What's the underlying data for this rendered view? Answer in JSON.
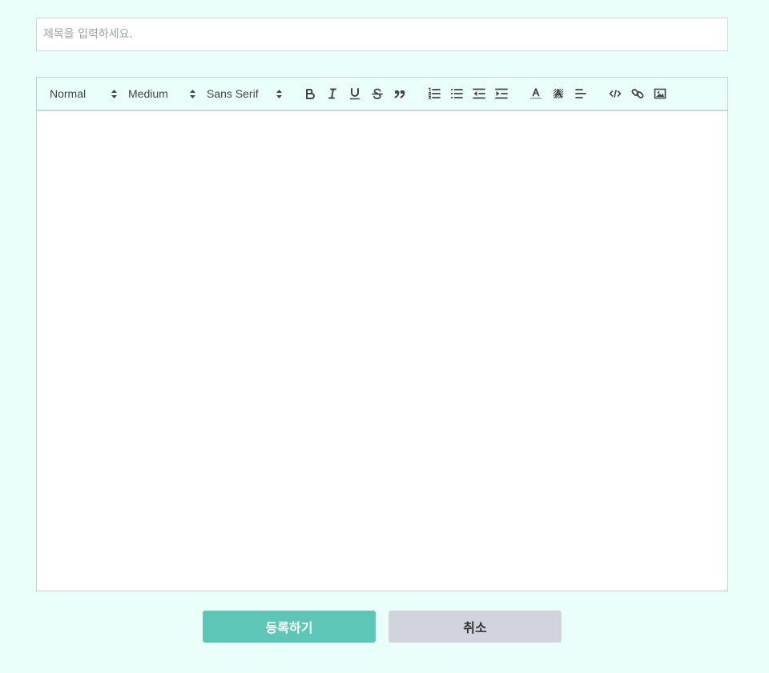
{
  "title_field": {
    "placeholder": "제목을 입력하세요.",
    "value": ""
  },
  "toolbar": {
    "header_picker": "Normal",
    "size_picker": "Medium",
    "font_picker": "Sans Serif",
    "buttons": [
      "bold-icon",
      "italic-icon",
      "underline-icon",
      "strike-icon",
      "blockquote-icon",
      "ordered-list-icon",
      "bullet-list-icon",
      "outdent-icon",
      "indent-icon",
      "text-color-icon",
      "background-color-icon",
      "align-icon",
      "code-block-icon",
      "link-icon",
      "image-icon"
    ]
  },
  "editor": {
    "content": ""
  },
  "actions": {
    "submit_label": "등록하기",
    "cancel_label": "취소"
  },
  "colors": {
    "page_background": "#eafff9",
    "submit_button": "#5ec6b6",
    "cancel_button": "#d1d4dc",
    "icon_stroke": "#444444"
  }
}
